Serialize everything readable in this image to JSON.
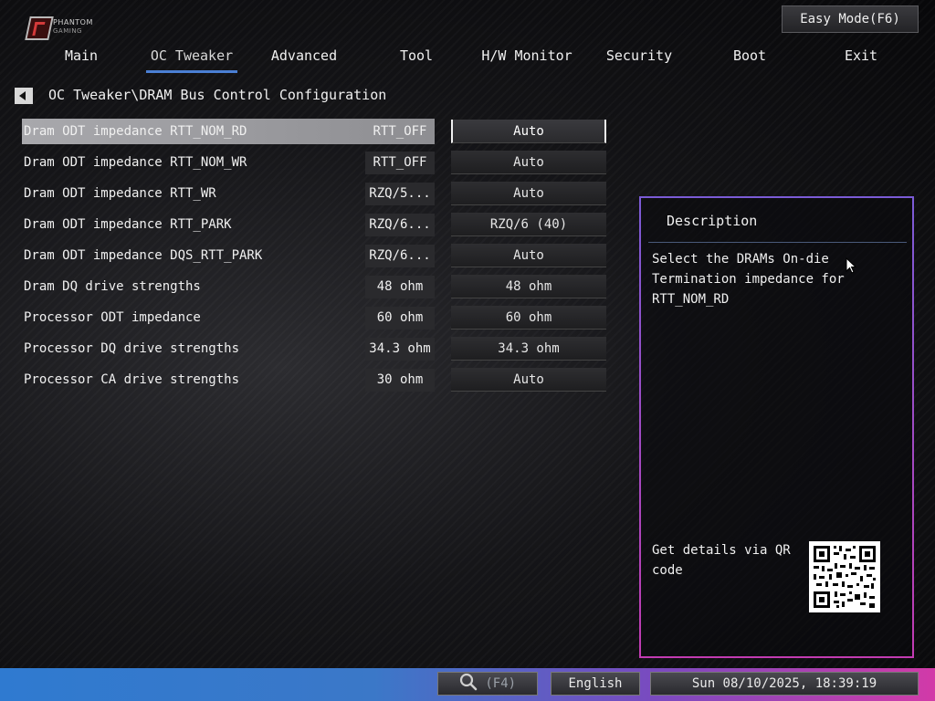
{
  "brand": {
    "line1": "PHANTOM",
    "line2": "GAMING"
  },
  "easy_mode_label": "Easy Mode(F6)",
  "nav": {
    "tabs": [
      {
        "label": "Main"
      },
      {
        "label": "OC Tweaker"
      },
      {
        "label": "Advanced"
      },
      {
        "label": "Tool"
      },
      {
        "label": "H/W Monitor"
      },
      {
        "label": "Security"
      },
      {
        "label": "Boot"
      },
      {
        "label": "Exit"
      }
    ],
    "active": "OC Tweaker"
  },
  "breadcrumb": "OC Tweaker\\DRAM Bus Control Configuration",
  "settings": [
    {
      "label": "Dram ODT impedance RTT_NOM_RD",
      "current": "RTT_OFF",
      "value": "Auto"
    },
    {
      "label": "Dram ODT impedance RTT_NOM_WR",
      "current": "RTT_OFF",
      "value": "Auto"
    },
    {
      "label": "Dram ODT impedance RTT_WR",
      "current": "RZQ/5...",
      "value": "Auto"
    },
    {
      "label": "Dram ODT impedance RTT_PARK",
      "current": "RZQ/6...",
      "value": "RZQ/6 (40)"
    },
    {
      "label": "Dram ODT impedance DQS_RTT_PARK",
      "current": "RZQ/6...",
      "value": "Auto"
    },
    {
      "label": "Dram DQ drive strengths",
      "current": "48 ohm",
      "value": "48 ohm"
    },
    {
      "label": "Processor ODT impedance",
      "current": "60 ohm",
      "value": "60 ohm"
    },
    {
      "label": "Processor DQ drive strengths",
      "current": "34.3 ohm",
      "value": "34.3 ohm"
    },
    {
      "label": "Processor CA drive strengths",
      "current": "30 ohm",
      "value": "Auto"
    }
  ],
  "description": {
    "title": "Description",
    "text": "Select the DRAMs On-die Termination impedance for RTT_NOM_RD",
    "qr_label": "Get details via QR code"
  },
  "footer": {
    "search_label": "(F4)",
    "language": "English",
    "datetime": "Sun 08/10/2025, 18:39:19"
  },
  "colors": {
    "accent": "#4a7fd4",
    "footer_left": "#2f7ad0",
    "footer_right": "#d23aa8",
    "desc_border_top": "#7b5bd6",
    "desc_border_bottom": "#c23bb2"
  },
  "icons": [
    "back-arrow-icon",
    "search-icon",
    "mouse-cursor-icon",
    "qr-code-icon"
  ]
}
